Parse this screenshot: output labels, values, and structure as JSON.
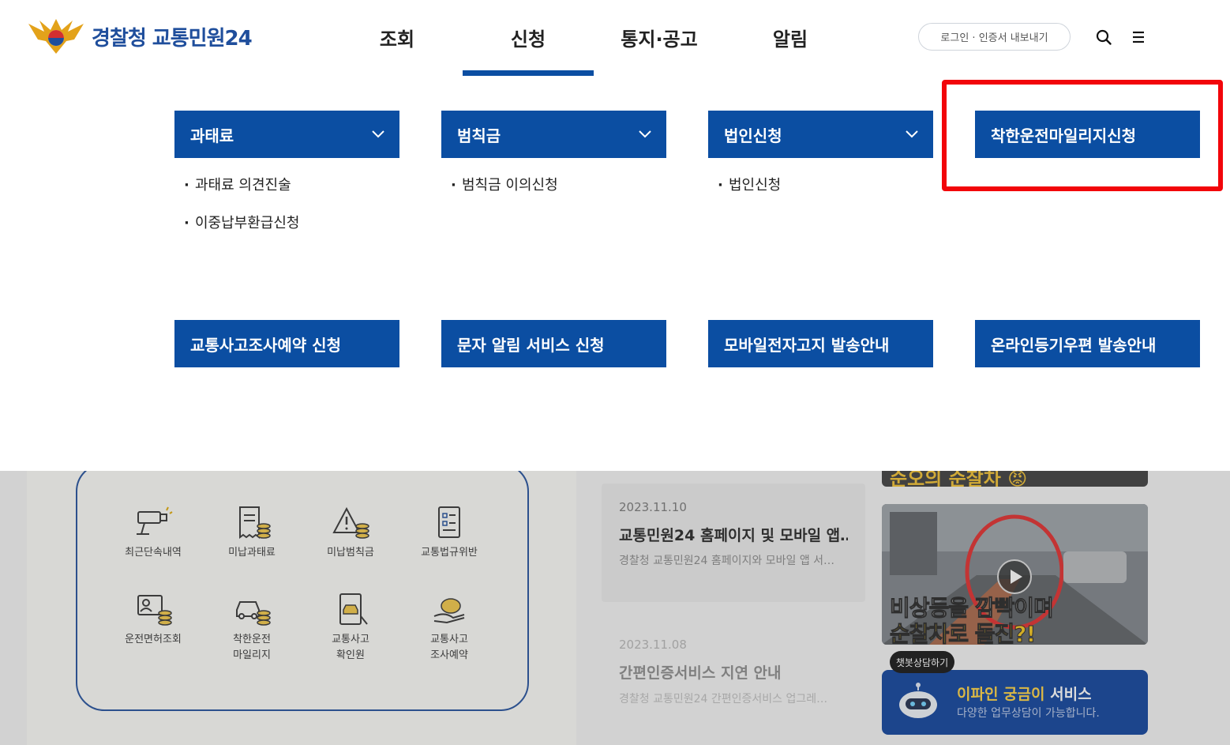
{
  "header": {
    "logo_text": "경찰청 교통민원24",
    "nav": [
      {
        "label": "조회",
        "active": false
      },
      {
        "label": "신청",
        "active": true
      },
      {
        "label": "통지·공고",
        "active": false
      },
      {
        "label": "알림",
        "active": false
      }
    ],
    "login_label": "로그인 · 인증서 내보내기",
    "icons": [
      "search-icon",
      "menu-icon"
    ]
  },
  "mega_menu": {
    "row1": [
      {
        "label": "과태료",
        "has_dropdown": true,
        "items": [
          "과태료 의견진술",
          "이중납부환급신청"
        ]
      },
      {
        "label": "범칙금",
        "has_dropdown": true,
        "items": [
          "범칙금 이의신청"
        ]
      },
      {
        "label": "법인신청",
        "has_dropdown": true,
        "items": [
          "법인신청"
        ]
      },
      {
        "label": "착한운전마일리지신청",
        "has_dropdown": false,
        "items": [],
        "highlighted": true
      }
    ],
    "row2": [
      {
        "label": "교통사고조사예약 신청"
      },
      {
        "label": "문자 알림 서비스 신청"
      },
      {
        "label": "모바일전자고지 발송안내"
      },
      {
        "label": "온라인등기우편 발송안내"
      }
    ]
  },
  "quick_menu": [
    {
      "label": "최근단속내역",
      "icon": "camera-icon"
    },
    {
      "label": "미납과태료",
      "icon": "receipt-coins-icon"
    },
    {
      "label": "미납범칙금",
      "icon": "warning-coins-icon"
    },
    {
      "label": "교통법규위반",
      "icon": "checklist-icon"
    },
    {
      "label": "운전면허조회",
      "icon": "id-card-icon"
    },
    {
      "label": "착한운전\n마일리지",
      "line1": "착한운전",
      "line2": "마일리지",
      "icon": "car-coins-icon"
    },
    {
      "label": "교통사고\n확인원",
      "line1": "교통사고",
      "line2": "확인원",
      "icon": "accident-document-icon"
    },
    {
      "label": "교통사고\n조사예약",
      "line1": "교통사고",
      "line2": "조사예약",
      "icon": "piggy-bank-icon"
    }
  ],
  "notices": [
    {
      "date": "2023.11.10",
      "title": "교통민원24 홈페이지 및 모바일 앱…",
      "desc": "경찰청 교통민원24 홈페이지와 모바일 앱 서…"
    },
    {
      "date": "2023.11.08",
      "title": "간편인증서비스 지연 안내",
      "desc": "경찰청 교통민원24 간편인증서비스 업그레…"
    }
  ],
  "banners": {
    "top_caption": "순오의 순찰차 😡",
    "video_caption_line1": "비상등을 깜빡이며",
    "video_caption_line2": "순찰차로 돌진?!"
  },
  "chatbot": {
    "tooltip": "챗봇상담하기",
    "title_highlight": "이파인 궁금이",
    "title_rest": " 서비스",
    "subtitle": "다양한 업무상담이 가능합니다."
  },
  "colors": {
    "primary": "#0b4ea2",
    "highlight_border": "#f2050a",
    "chat_bg": "#0b3f9a"
  }
}
